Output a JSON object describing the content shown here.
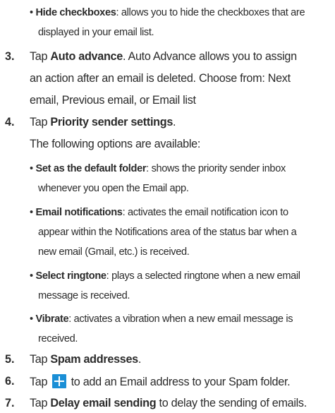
{
  "bullet_hide_checkboxes": {
    "bullet": "•",
    "term": "Hide checkboxes",
    "line1_rest": ": allows you to hide the checkboxes that are",
    "line2": "displayed in your email list."
  },
  "step3": {
    "number": "3.",
    "pre": "Tap ",
    "term": "Auto advance",
    "line1_rest": ". Auto Advance allows you to assign",
    "line2": "an action after an email is deleted. Choose from: Next",
    "line3": "email, Previous email, or Email list"
  },
  "step4": {
    "number": "4.",
    "pre": "Tap ",
    "term": "Priority sender settings",
    "post": ".",
    "intro": "The following options are available:",
    "options": [
      {
        "bullet": "•",
        "term": "Set as the default folder",
        "line1_rest": ": shows the priority sender inbox",
        "line2": "whenever you open the Email app."
      },
      {
        "bullet": "•",
        "term": "Email notifications",
        "line1_rest": ": activates the email notification icon to",
        "line2": "appear within the Notifications area of the status bar when a",
        "line3": "new email (Gmail, etc.) is received."
      },
      {
        "bullet": "•",
        "term": "Select ringtone",
        "line1_rest": ": plays a selected ringtone when a new email",
        "line2": "message is received."
      },
      {
        "bullet": "•",
        "term": "Vibrate",
        "line1_rest": ": activates a vibration when a new email message is",
        "line2": "received."
      }
    ]
  },
  "step5": {
    "number": "5.",
    "pre": "Tap ",
    "term": "Spam addresses",
    "post": "."
  },
  "step6": {
    "number": "6.",
    "pre": "Tap ",
    "icon": "plus-icon",
    "post": " to add an Email address to your Spam folder."
  },
  "step7": {
    "number": "7.",
    "pre": "Tap ",
    "term": "Delay email sending",
    "post": " to delay the sending of emails."
  },
  "colors": {
    "text": "#2b2b2b",
    "accent": "#1b8fd6"
  }
}
